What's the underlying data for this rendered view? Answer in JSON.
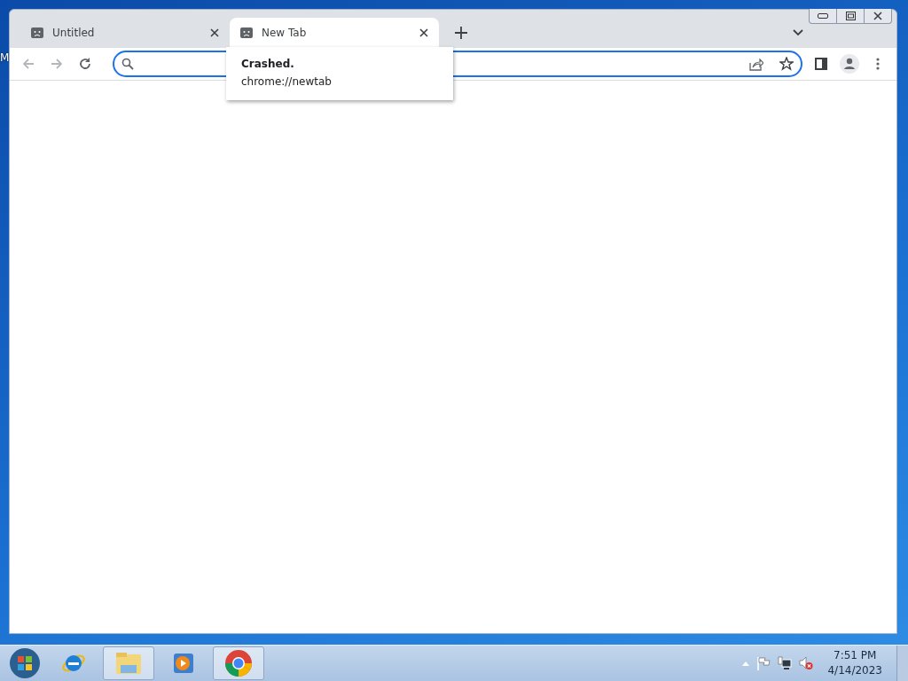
{
  "desktop": {
    "labels": [
      "M"
    ]
  },
  "browser": {
    "tabs": [
      {
        "title": "Untitled",
        "selected": false
      },
      {
        "title": "New Tab",
        "selected": true
      }
    ],
    "nav_buttons": [
      {
        "kind": "back",
        "disabled": true
      },
      {
        "kind": "forward",
        "disabled": true
      },
      {
        "kind": "reload",
        "disabled": false
      }
    ],
    "address_bar": {
      "focused": true
    },
    "tooltip": {
      "title": "Crashed.",
      "url": "chrome://newtab"
    }
  },
  "taskbar": {
    "apps": [
      {
        "kind": "ie",
        "running": false
      },
      {
        "kind": "explorer",
        "running": true
      },
      {
        "kind": "media",
        "running": false
      },
      {
        "kind": "chrome",
        "running": true
      }
    ],
    "clock": {
      "time": "7:51 PM",
      "date": "4/14/2023"
    }
  }
}
